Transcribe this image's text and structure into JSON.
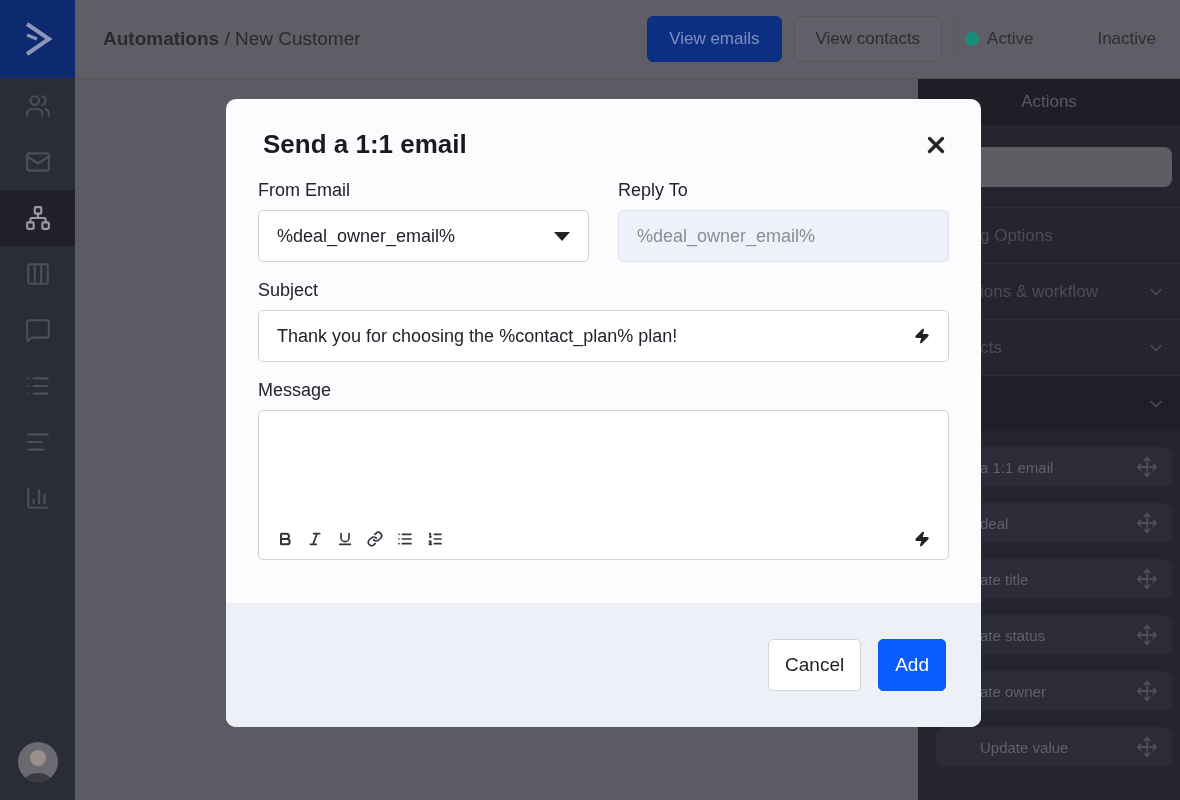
{
  "sidebar": {
    "items": [
      {
        "kind": "contacts",
        "selected": false
      },
      {
        "kind": "campaigns",
        "selected": false
      },
      {
        "kind": "automations",
        "selected": true
      },
      {
        "kind": "deals",
        "selected": false
      },
      {
        "kind": "conversations",
        "selected": false
      },
      {
        "kind": "lists",
        "selected": false
      },
      {
        "kind": "forms",
        "selected": false
      },
      {
        "kind": "reports",
        "selected": false
      }
    ]
  },
  "topbar": {
    "breadcrumb": "**Automations** / New Customer",
    "buttons": [
      {
        "label": "View emails",
        "kind": "primary"
      },
      {
        "label": "View contacts",
        "kind": "secondary"
      }
    ],
    "status_toggle": [
      {
        "label": "Active",
        "selected": true
      },
      {
        "label": "Inactive",
        "selected": false
      }
    ]
  },
  "actions_panel": {
    "title": "Actions",
    "sections": [
      {
        "kind": "heading",
        "label": "g Options"
      },
      {
        "kind": "group",
        "label": "ions & workflow"
      },
      {
        "kind": "group",
        "label": "cts"
      },
      {
        "kind": "group",
        "items": [
          "a 1:1 email",
          "deal",
          "ate title",
          "ate status",
          "ate owner",
          "Update value"
        ]
      }
    ]
  },
  "dialog": {
    "title": "Send a 1:1 email",
    "from_email": {
      "label": "From Email",
      "value": "%deal_owner_email%"
    },
    "reply_to": {
      "label": "Reply To",
      "placeholder": "%deal_owner_email%",
      "disabled": true
    },
    "subject": {
      "label": "Subject",
      "value": "Thank you for choosing the %contact_plan% plan!"
    },
    "message": {
      "label": "Message"
    },
    "buttons": [
      {
        "label": "Cancel",
        "kind": "secondary"
      },
      {
        "label": "Add",
        "kind": "primary"
      }
    ]
  }
}
